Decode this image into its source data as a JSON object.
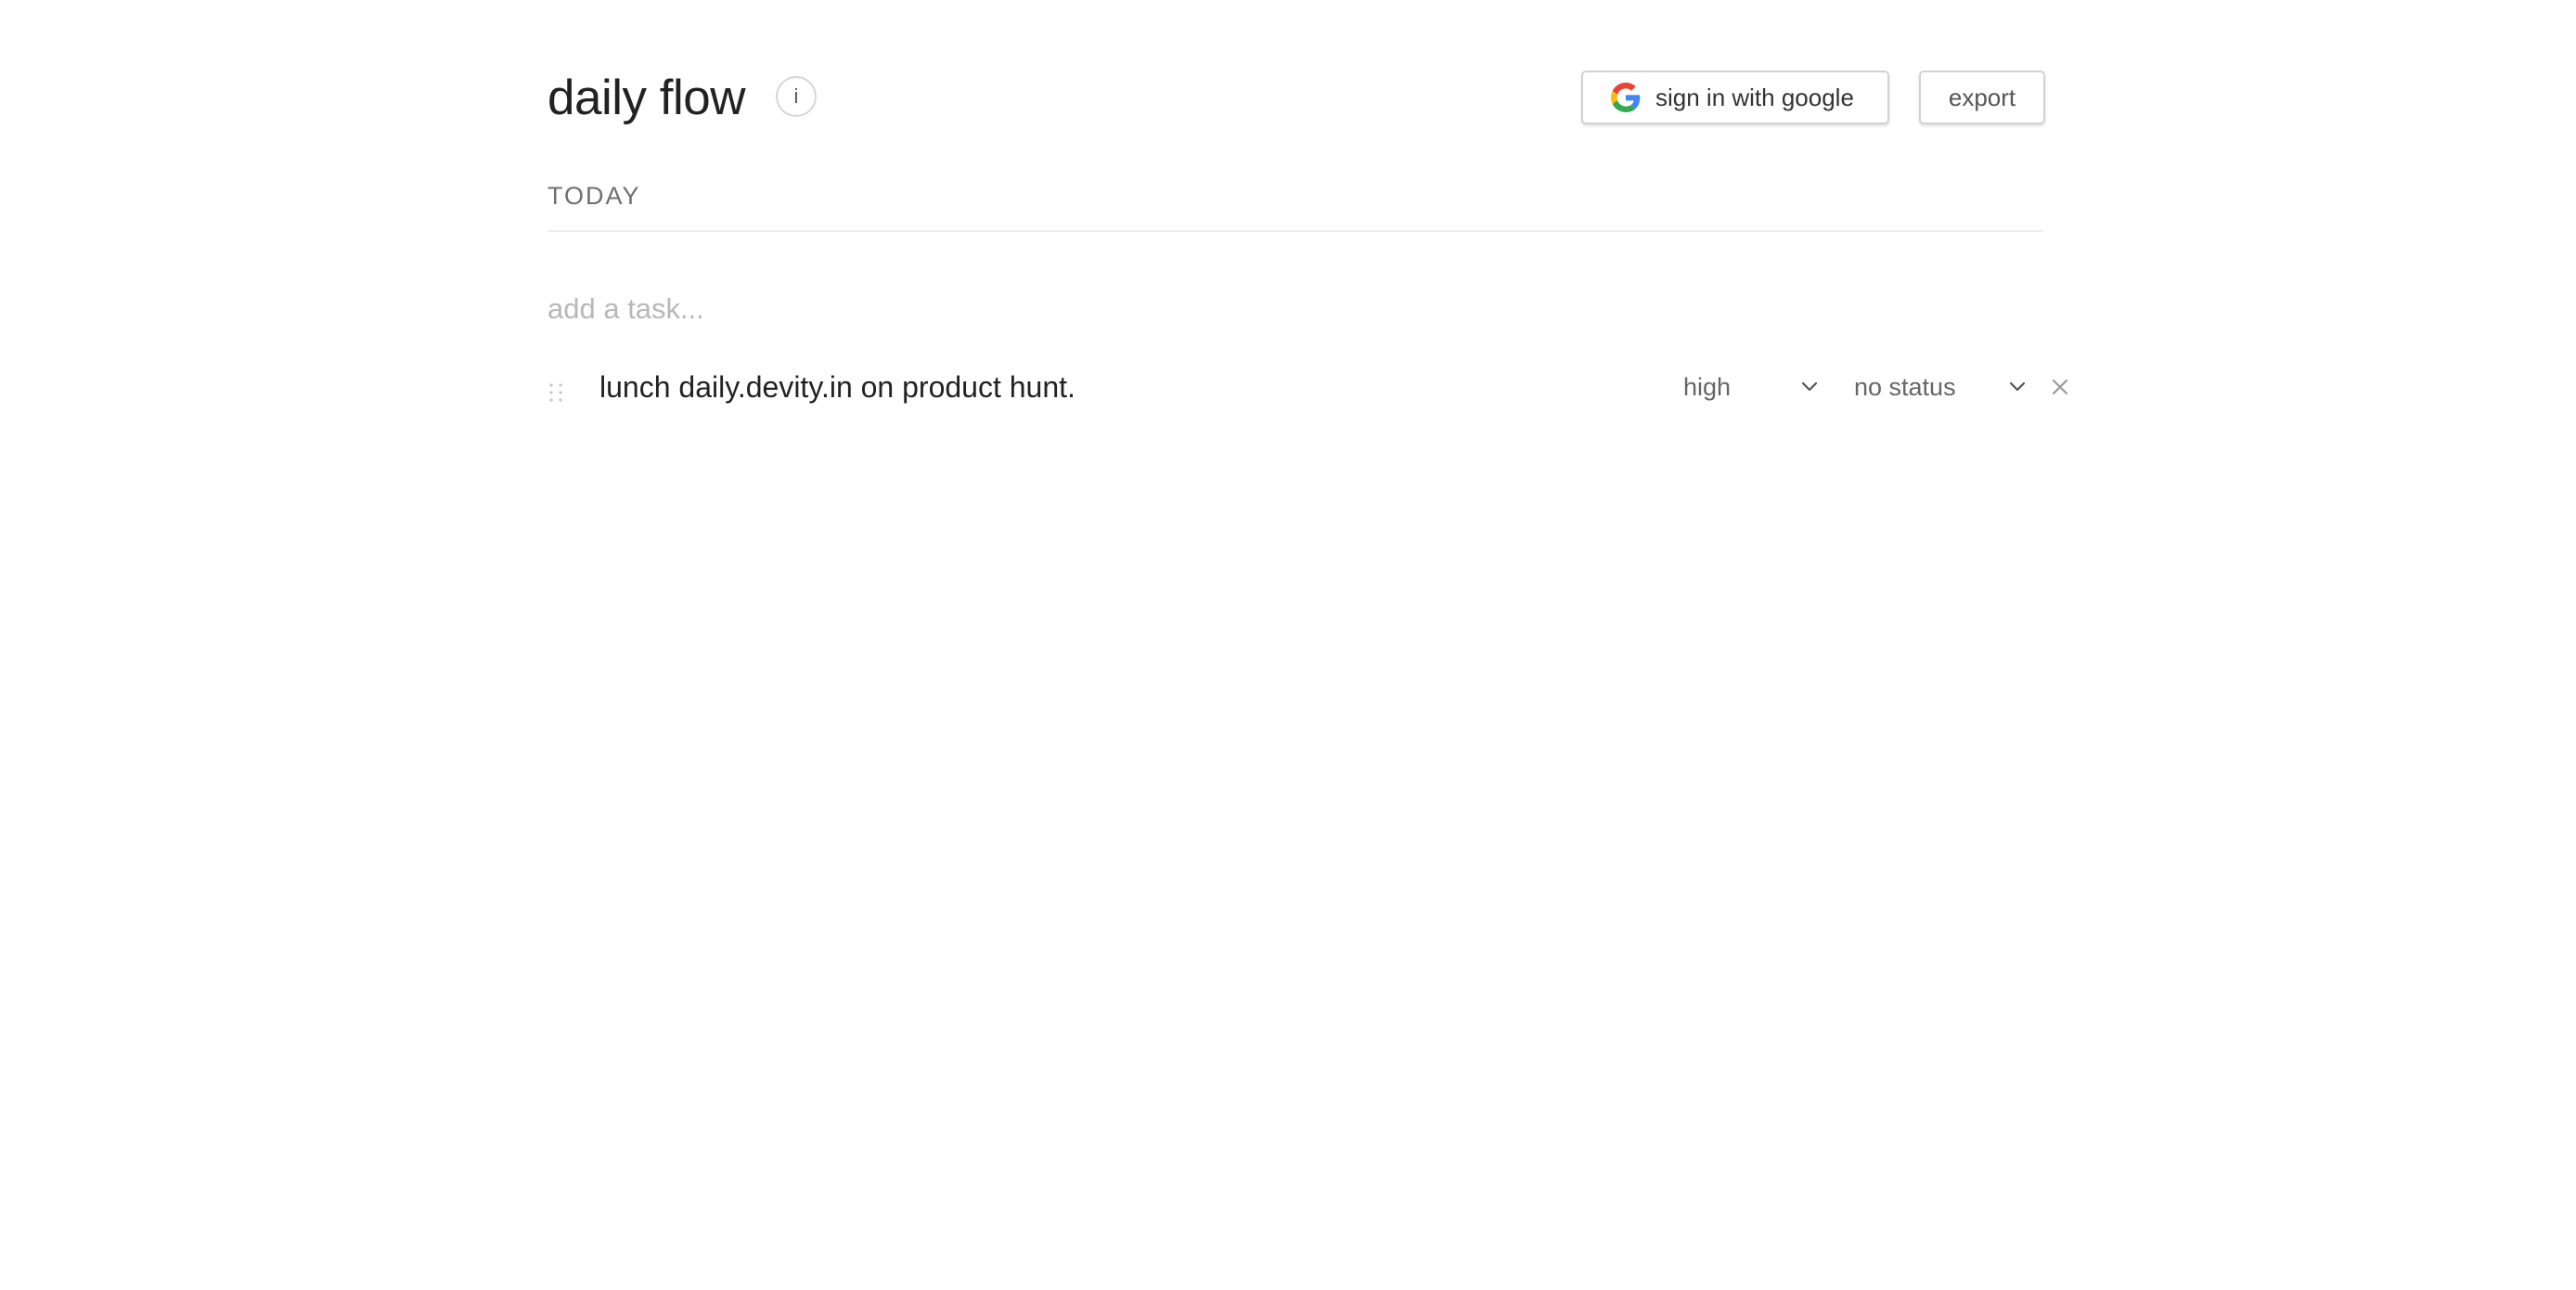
{
  "header": {
    "title": "daily flow",
    "info_label": "i",
    "google_button_label": "sign in with google",
    "export_label": "export"
  },
  "section": {
    "label": "TODAY"
  },
  "task_input": {
    "placeholder": "add a task...",
    "value": ""
  },
  "tasks": [
    {
      "text": "lunch daily.devity.in on product hunt.",
      "priority": "high",
      "status": "no status"
    }
  ],
  "icons": {
    "google": "google-g-logo",
    "drag": "drag-handle-icon",
    "chevron": "chevron-down-icon",
    "remove": "close-icon"
  },
  "colors": {
    "google_blue": "#4285F4",
    "google_red": "#EA4335",
    "google_yellow": "#FBBC05",
    "google_green": "#34A853"
  }
}
